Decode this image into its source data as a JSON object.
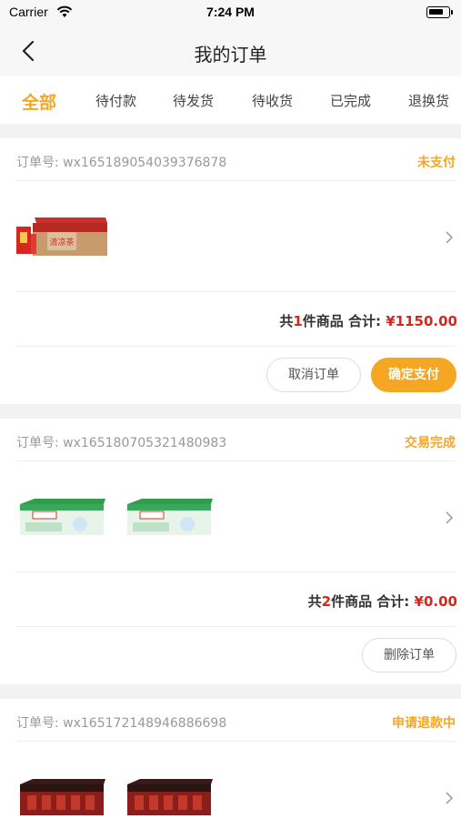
{
  "status_bar": {
    "carrier": "Carrier",
    "time": "7:24 PM"
  },
  "nav": {
    "title": "我的订单"
  },
  "tabs": [
    {
      "label": "全部",
      "active": true
    },
    {
      "label": "待付款",
      "active": false
    },
    {
      "label": "待发货",
      "active": false
    },
    {
      "label": "待收货",
      "active": false
    },
    {
      "label": "已完成",
      "active": false
    },
    {
      "label": "退换货",
      "active": false
    }
  ],
  "orders": [
    {
      "order_no": "订单号: wx16518905403937​6878",
      "status": "未支付",
      "product_images": [
        "red-drink-box-image"
      ],
      "count_prefix": "共",
      "count": "1",
      "count_suffix": "件商品 合计:",
      "total": "¥1150.00",
      "buttons": [
        "取消订单",
        "确定支付"
      ]
    },
    {
      "order_no": "订单号: wx165180705321480983",
      "status": "交易完成",
      "product_images": [
        "green-drink-box-image",
        "green-drink-box-image"
      ],
      "count_prefix": "共",
      "count": "2",
      "count_suffix": "件商品 合计:",
      "total": "¥0.00",
      "buttons": [
        "删除订单"
      ]
    },
    {
      "order_no": "订单号: wx165172148946886698",
      "status": "申请退款中",
      "product_images": [
        "dark-red-drink-box-image",
        "dark-red-drink-box-image"
      ]
    }
  ],
  "colors": {
    "accent": "#f5a623",
    "price": "#d9251c"
  }
}
